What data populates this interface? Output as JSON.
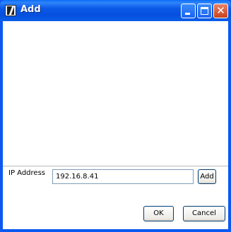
{
  "window": {
    "title": "Add",
    "app_icon": "k-logo-icon",
    "controls": {
      "minimize": "minimize-icon",
      "maximize": "maximize-icon",
      "close": "close-icon",
      "close_glyph": "✕"
    }
  },
  "form": {
    "ip_label": "IP Address",
    "ip_value": "192.16.8.41",
    "add_label": "Add"
  },
  "footer": {
    "ok_label": "OK",
    "cancel_label": "Cancel"
  },
  "colors": {
    "titlebar": "#0a59f0",
    "close_button": "#d9552e",
    "input_border": "#7f9db9",
    "button_border": "#003c74"
  }
}
